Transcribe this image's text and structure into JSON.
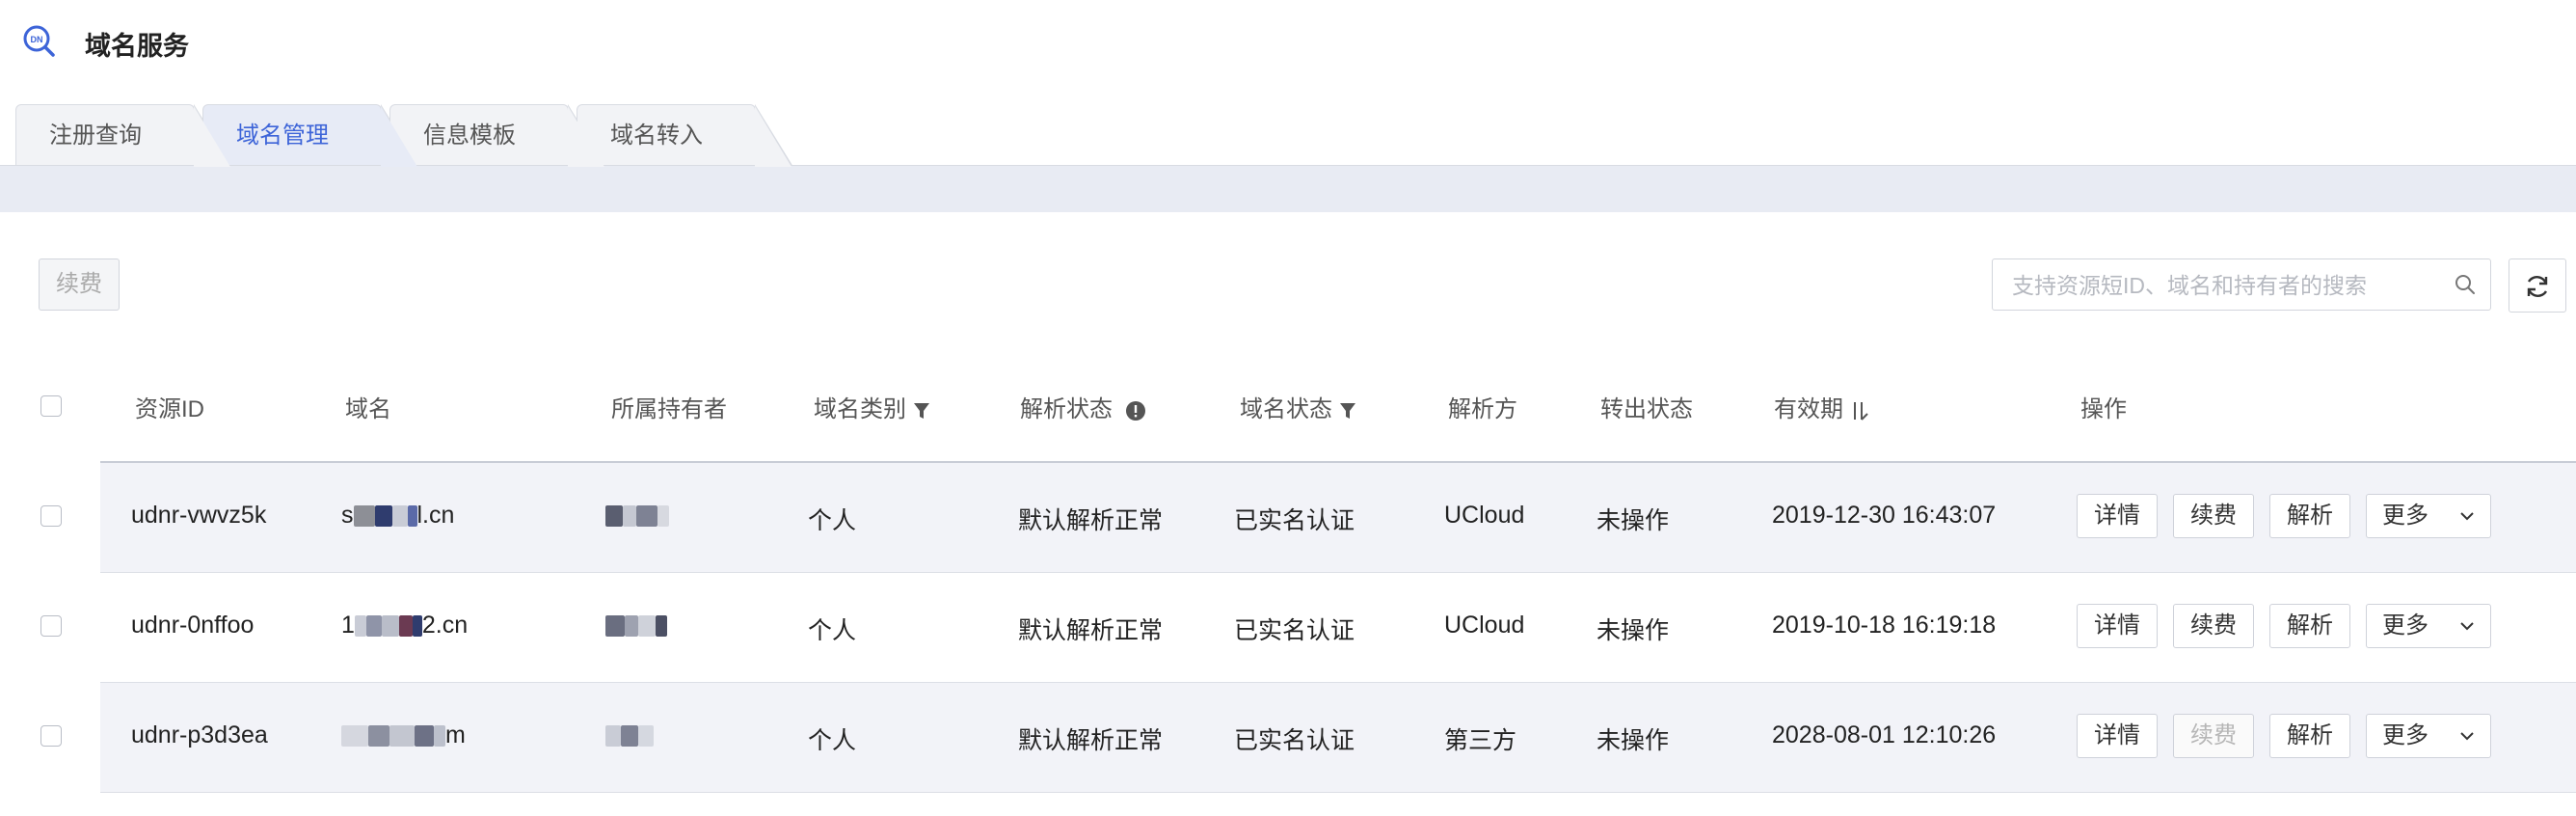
{
  "app": {
    "title": "域名服务"
  },
  "tabs": [
    {
      "label": "注册查询"
    },
    {
      "label": "域名管理"
    },
    {
      "label": "信息模板"
    },
    {
      "label": "域名转入"
    }
  ],
  "toolbar": {
    "renew_label": "续费",
    "search_placeholder": "支持资源短ID、域名和持有者的搜索"
  },
  "table": {
    "headers": {
      "id": "资源ID",
      "domain": "域名",
      "owner": "所属持有者",
      "type": "域名类别",
      "dns_status": "解析状态",
      "domain_status": "域名状态",
      "resolver": "解析方",
      "transfer": "转出状态",
      "expiry": "有效期",
      "actions": "操作"
    },
    "rows": [
      {
        "id": "udnr-vwvz5k",
        "domain_pre": "s",
        "domain_suf": "l.cn",
        "type": "个人",
        "dns_status": "默认解析正常",
        "domain_status": "已实名认证",
        "resolver": "UCloud",
        "transfer": "未操作",
        "expiry": "2019-12-30 16:43:07",
        "renew_disabled": false
      },
      {
        "id": "udnr-0nffoo",
        "domain_pre": "1",
        "domain_suf": "2.cn",
        "type": "个人",
        "dns_status": "默认解析正常",
        "domain_status": "已实名认证",
        "resolver": "UCloud",
        "transfer": "未操作",
        "expiry": "2019-10-18 16:19:18",
        "renew_disabled": false
      },
      {
        "id": "udnr-p3d3ea",
        "domain_pre": "",
        "domain_suf": "m",
        "type": "个人",
        "dns_status": "默认解析正常",
        "domain_status": "已实名认证",
        "resolver": "第三方",
        "transfer": "未操作",
        "expiry": "2028-08-01 12:10:26",
        "renew_disabled": true
      }
    ],
    "actions": {
      "detail": "详情",
      "renew": "续费",
      "resolve": "解析",
      "more": "更多"
    }
  },
  "colors": {
    "accent": "#3d64d8",
    "row_shade": "#f2f3f8",
    "band": "#e8ebf3"
  },
  "icons": [
    "domain-logo-icon",
    "search-icon",
    "refresh-icon",
    "filter-icon",
    "info-icon",
    "sort-icon",
    "chevron-down-icon"
  ]
}
